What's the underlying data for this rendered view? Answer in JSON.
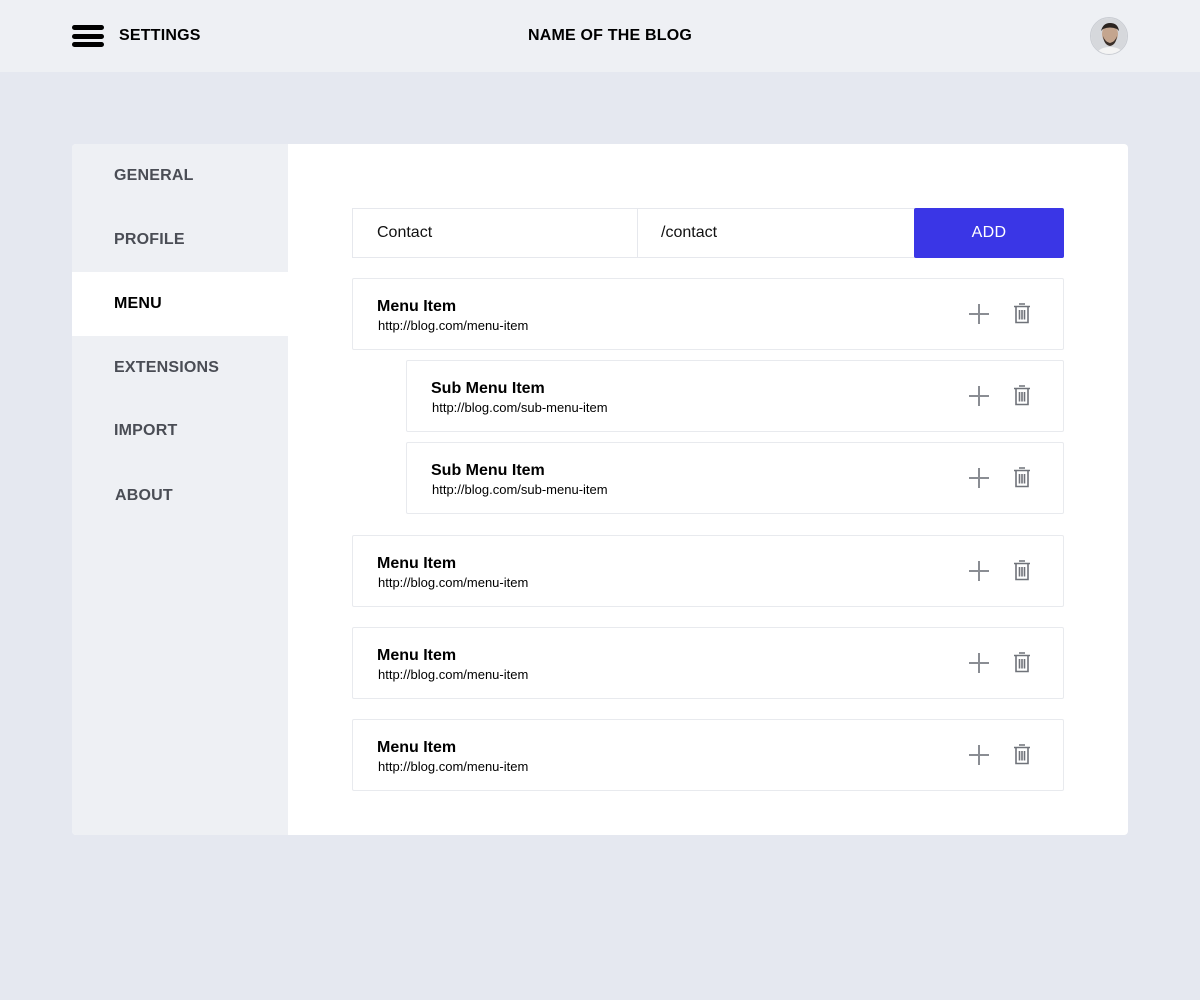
{
  "header": {
    "settings_label": "SETTINGS",
    "blog_title": "NAME OF THE BLOG"
  },
  "sidebar": {
    "items": [
      {
        "label": "GENERAL",
        "active": false
      },
      {
        "label": "PROFILE",
        "active": false
      },
      {
        "label": "MENU",
        "active": true
      },
      {
        "label": "EXTENSIONS",
        "active": false
      },
      {
        "label": "IMPORT",
        "active": false
      },
      {
        "label": "ABOUT",
        "active": false
      }
    ]
  },
  "add_form": {
    "name_value": "Contact",
    "url_value": "/contact",
    "add_label": "ADD"
  },
  "menu": {
    "items": [
      {
        "title": "Menu Item",
        "url": "http://blog.com/menu-item",
        "level": 0
      },
      {
        "title": "Sub Menu Item",
        "url": "http://blog.com/sub-menu-item",
        "level": 1
      },
      {
        "title": "Sub Menu Item",
        "url": "http://blog.com/sub-menu-item",
        "level": 1
      },
      {
        "title": "Menu Item",
        "url": "http://blog.com/menu-item",
        "level": 0
      },
      {
        "title": "Menu Item",
        "url": "http://blog.com/menu-item",
        "level": 0
      },
      {
        "title": "Menu Item",
        "url": "http://blog.com/menu-item",
        "level": 0
      }
    ]
  },
  "colors": {
    "accent": "#3a36e6",
    "page_background": "#e5e8f0",
    "sidebar_background": "#eef0f4",
    "icon_gray": "#8a8d93"
  },
  "icons": {
    "menu": "hamburger-menu-icon",
    "add": "plus-icon",
    "delete": "trash-icon"
  }
}
